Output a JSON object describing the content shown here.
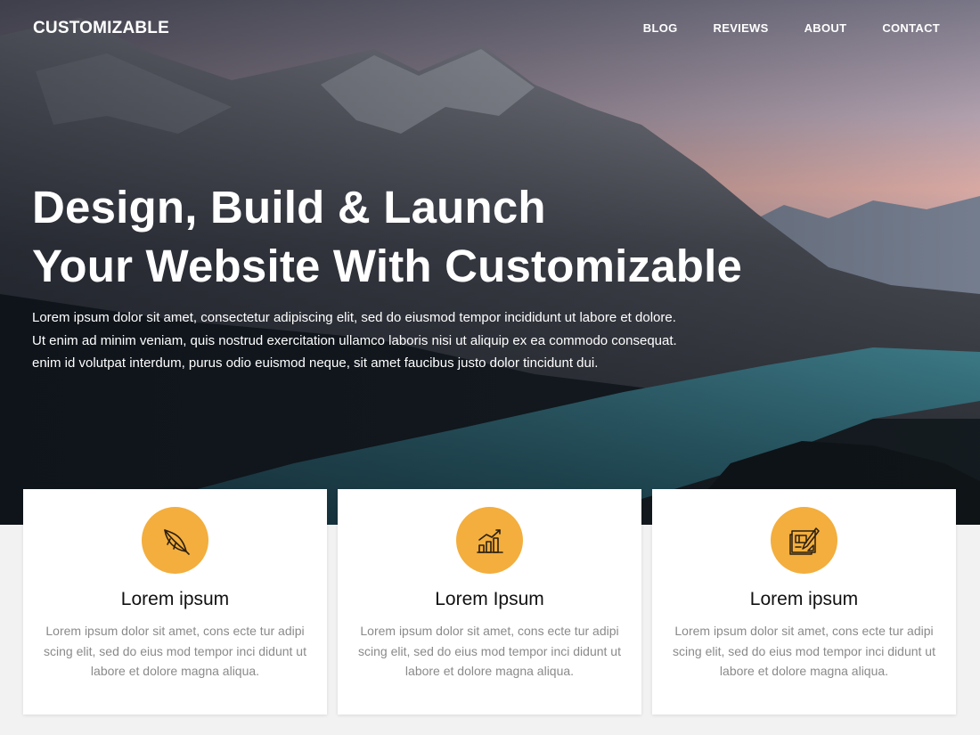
{
  "header": {
    "brand": "CUSTOMIZABLE",
    "nav": [
      "BLOG",
      "REVIEWS",
      "ABOUT",
      "CONTACT"
    ]
  },
  "hero": {
    "headline_line1": "Design, Build & Launch",
    "headline_line2": "Your Website With Customizable",
    "lead_line1": "Lorem ipsum dolor sit amet, consectetur adipiscing elit, sed do eiusmod tempor incididunt ut labore et dolore.",
    "lead_line2": "Ut enim ad minim veniam, quis nostrud exercitation ullamco laboris nisi ut aliquip ex ea commodo consequat.",
    "lead_line3": "enim id volutpat interdum, purus odio euismod neque, sit amet faucibus justo dolor tincidunt dui."
  },
  "features": [
    {
      "icon": "feather-icon",
      "title": "Lorem ipsum",
      "text": "Lorem ipsum dolor sit amet, cons ecte tur adipi scing elit, sed do eius mod tempor inci didunt ut labore et dolore magna aliqua."
    },
    {
      "icon": "growth-chart-icon",
      "title": "Lorem Ipsum",
      "text": "Lorem ipsum dolor sit amet, cons ecte tur adipi scing elit, sed do eius mod tempor inci didunt ut labore et dolore magna aliqua."
    },
    {
      "icon": "blueprint-design-icon",
      "title": "Lorem ipsum",
      "text": "Lorem ipsum dolor sit amet, cons ecte tur adipi scing elit, sed do eius mod tempor inci didunt ut labore et dolore magna aliqua."
    }
  ],
  "colors": {
    "accent": "#f3ae3d",
    "card_bg": "#ffffff",
    "page_bg": "#f2f2f2"
  }
}
